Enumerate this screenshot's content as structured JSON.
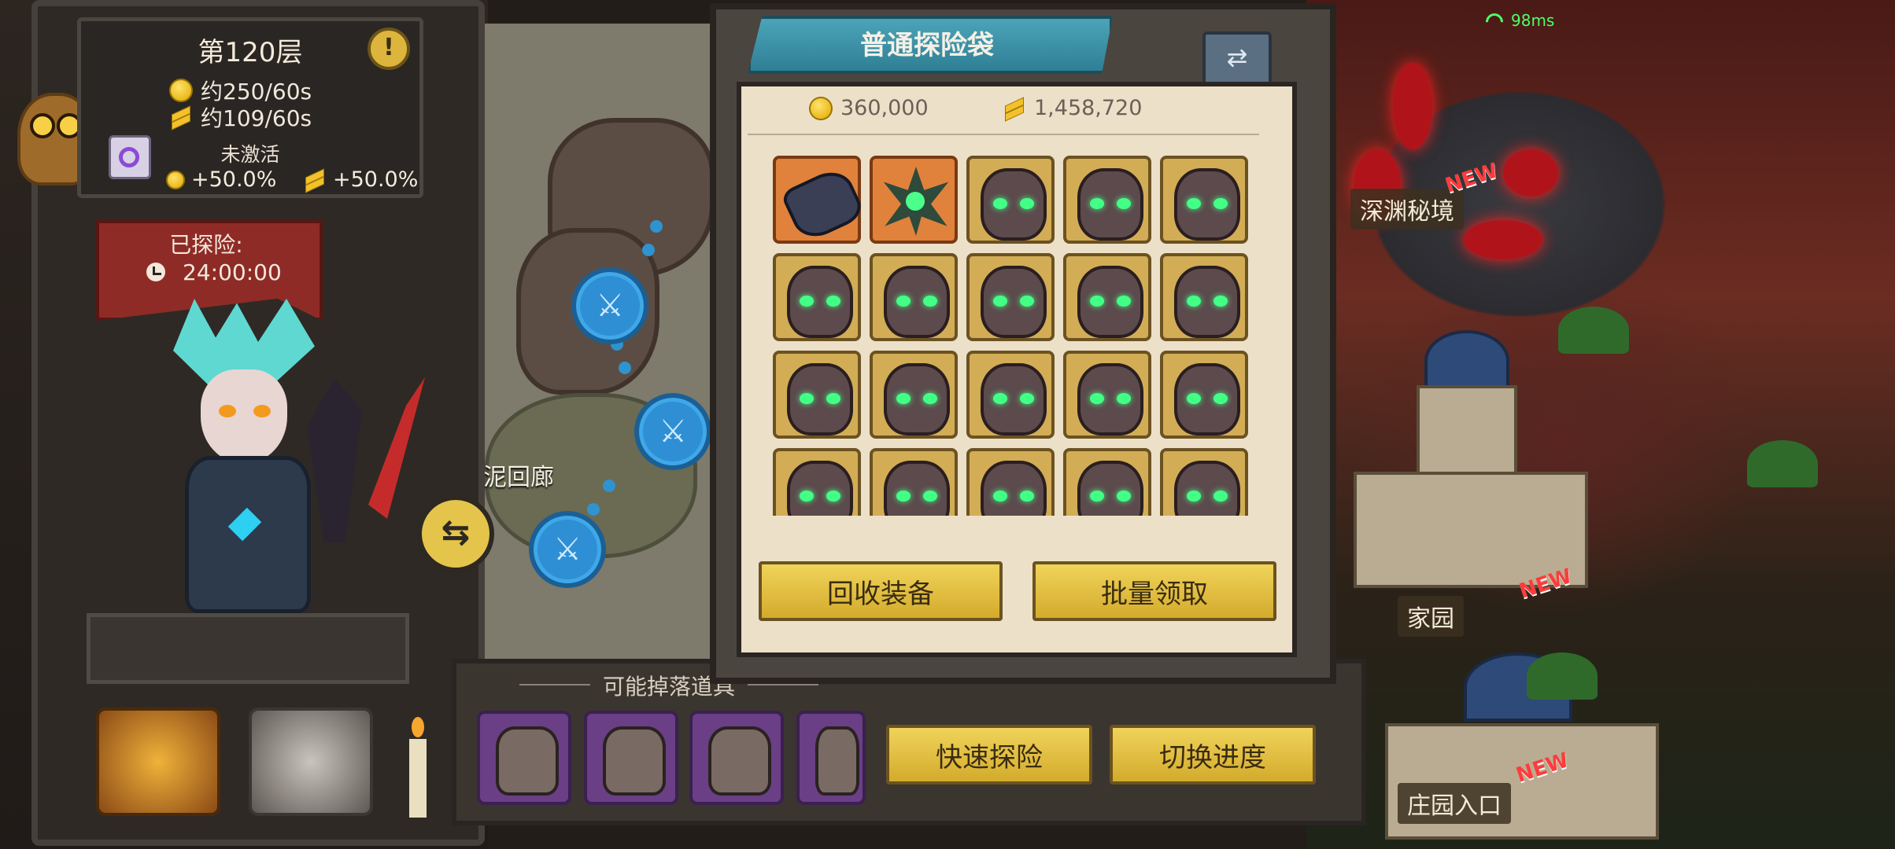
{
  "status": {
    "ping": "98ms"
  },
  "floor_panel": {
    "title": "第120层",
    "gold_rate": "约250/60s",
    "exp_rate": "约109/60s",
    "buff_status": "未激活",
    "gold_bonus": "+50.0%",
    "exp_bonus": "+50.0%"
  },
  "explore": {
    "label": "已探险:",
    "time": "24:00:00"
  },
  "map": {
    "area_label": "泥回廊"
  },
  "bag": {
    "title": "普通探险袋",
    "gold": "360,000",
    "exp": "1,458,720",
    "recycle_button": "回收装备",
    "claim_button": "批量领取",
    "items": [
      {
        "type": "gauntlet",
        "rarity": "orange"
      },
      {
        "type": "spiked-orb",
        "rarity": "orange"
      },
      {
        "type": "skull-helm",
        "rarity": "gold"
      },
      {
        "type": "skull-helm",
        "rarity": "gold"
      },
      {
        "type": "skull-helm",
        "rarity": "gold"
      },
      {
        "type": "skull-helm",
        "rarity": "gold"
      },
      {
        "type": "skull-helm",
        "rarity": "gold"
      },
      {
        "type": "skull-helm",
        "rarity": "gold"
      },
      {
        "type": "skull-helm",
        "rarity": "gold"
      },
      {
        "type": "skull-helm",
        "rarity": "gold"
      },
      {
        "type": "skull-helm",
        "rarity": "gold"
      },
      {
        "type": "skull-helm",
        "rarity": "gold"
      },
      {
        "type": "skull-helm",
        "rarity": "gold"
      },
      {
        "type": "skull-helm",
        "rarity": "gold"
      },
      {
        "type": "skull-helm",
        "rarity": "gold"
      },
      {
        "type": "skull-helm",
        "rarity": "gold"
      },
      {
        "type": "skull-helm",
        "rarity": "gold"
      },
      {
        "type": "skull-helm",
        "rarity": "gold"
      },
      {
        "type": "skull-helm",
        "rarity": "gold"
      },
      {
        "type": "skull-helm",
        "rarity": "gold"
      }
    ]
  },
  "drops": {
    "title": "可能掉落道具",
    "quick_explore_button": "快速探险",
    "switch_progress_button": "切换进度"
  },
  "scene": {
    "abyss_label": "深渊秘境",
    "home_label": "家园",
    "manor_label": "庄园入口",
    "new_tag": "NEW"
  },
  "colors": {
    "gold_button": "#e4c44a",
    "ribbon": "#3a93aa",
    "item_gold": "#d3ad55",
    "item_orange": "#e0823c",
    "drop_item": "#6a3f86"
  }
}
